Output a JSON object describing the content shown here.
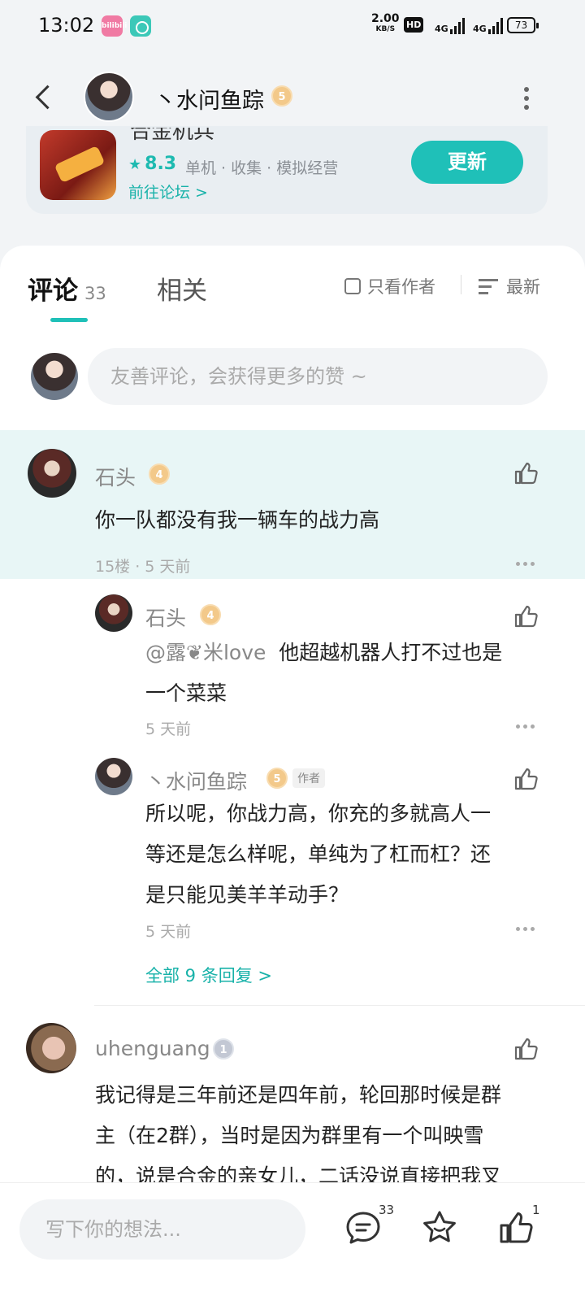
{
  "status_bar": {
    "time": "13:02",
    "bili_label": "bilibili",
    "speed_value": "2.00",
    "speed_unit": "KB/S",
    "hd_label": "HD",
    "network_1": "4G",
    "network_2": "4G",
    "battery": "73"
  },
  "header": {
    "title": "丶水问鱼踪",
    "level": "5"
  },
  "game": {
    "title_partial": "合金机兵",
    "rating": "8.3",
    "tags": "单机 · 收集 · 模拟经营",
    "forum_link": "前往论坛 >",
    "update_label": "更新"
  },
  "tabs": {
    "comments_label": "评论",
    "comments_count": "33",
    "related_label": "相关",
    "only_author": "只看作者",
    "sort_label": "最新"
  },
  "comment_input": {
    "placeholder": "友善评论，会获得更多的赞 ~"
  },
  "comments": [
    {
      "user": "石头",
      "level": "4",
      "text": "你一队都没有我一辆车的战力高",
      "meta": "15楼 · 5 天前"
    },
    {
      "user": "uhenguang",
      "level": "1",
      "text_1": "我记得是三年前还是四年前，轮回那时候是群",
      "text_2": "主（在2群），当时是因为群里有一个叫映雪",
      "text_3": "的，说是合金的亲女儿，二话没说直接把我叉"
    }
  ],
  "replies": [
    {
      "user": "石头",
      "level": "4",
      "mention": "@露❦米love",
      "text_1": "他超越机器人打不过也是",
      "text_2": "一个菜菜",
      "meta": "5 天前"
    },
    {
      "user": "丶水问鱼踪",
      "level": "5",
      "author_tag": "作者",
      "text_1": "所以呢，你战力高，你充的多就高人一",
      "text_2": "等还是怎么样呢，单纯为了杠而杠？还",
      "text_3": "是只能见美羊羊动手？",
      "meta": "5 天前"
    }
  ],
  "all_replies_label": "全部 9 条回复 >",
  "bottom_bar": {
    "placeholder": "写下你的想法...",
    "comment_count": "33",
    "like_count": "1"
  },
  "colors": {
    "accent": "#1fc0b8",
    "highlight_bg": "#e8f6f6",
    "badge_gold": "#f3c98a"
  }
}
